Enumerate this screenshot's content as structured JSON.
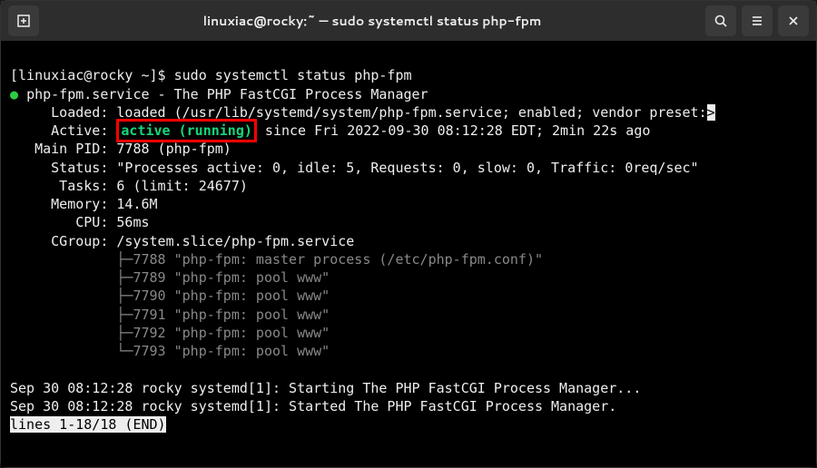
{
  "titlebar": {
    "title": "linuxiac@rocky:~ — sudo systemctl status php-fpm"
  },
  "prompt": {
    "user_host": "[linuxiac@rocky ~]$ ",
    "command": "sudo systemctl status php-fpm"
  },
  "service": {
    "dot": "●",
    "name": "php-fpm.service",
    "dash": " - ",
    "desc": "The PHP FastCGI Process Manager",
    "loaded_label": "     Loaded: ",
    "loaded_value": "loaded (/usr/lib/systemd/system/php-fpm.service; enabled; vendor preset:",
    "active_label": "     Active: ",
    "active_status": "active (running)",
    "active_since": " since Fri 2022-09-30 08:12:28 EDT; 2min 22s ago",
    "mainpid_label": "   Main PID: ",
    "mainpid_value": "7788 (php-fpm)",
    "status_label": "     Status: ",
    "status_value": "\"Processes active: 0, idle: 5, Requests: 0, slow: 0, Traffic: 0req/sec\"",
    "tasks_label": "      Tasks: ",
    "tasks_value": "6 (limit: 24677)",
    "memory_label": "     Memory: ",
    "memory_value": "14.6M",
    "cpu_label": "        CPU: ",
    "cpu_value": "56ms",
    "cgroup_label": "     CGroup: ",
    "cgroup_value": "/system.slice/php-fpm.service"
  },
  "tree": {
    "l1": "             ├─7788 \"php-fpm: master process (/etc/php-fpm.conf)\"",
    "l2": "             ├─7789 \"php-fpm: pool www\"",
    "l3": "             ├─7790 \"php-fpm: pool www\"",
    "l4": "             ├─7791 \"php-fpm: pool www\"",
    "l5": "             ├─7792 \"php-fpm: pool www\"",
    "l6": "             └─7793 \"php-fpm: pool www\""
  },
  "log": {
    "l1": "Sep 30 08:12:28 rocky systemd[1]: Starting The PHP FastCGI Process Manager...",
    "l2": "Sep 30 08:12:28 rocky systemd[1]: Started The PHP FastCGI Process Manager."
  },
  "pager": {
    "status": "lines 1-18/18 (END)"
  }
}
